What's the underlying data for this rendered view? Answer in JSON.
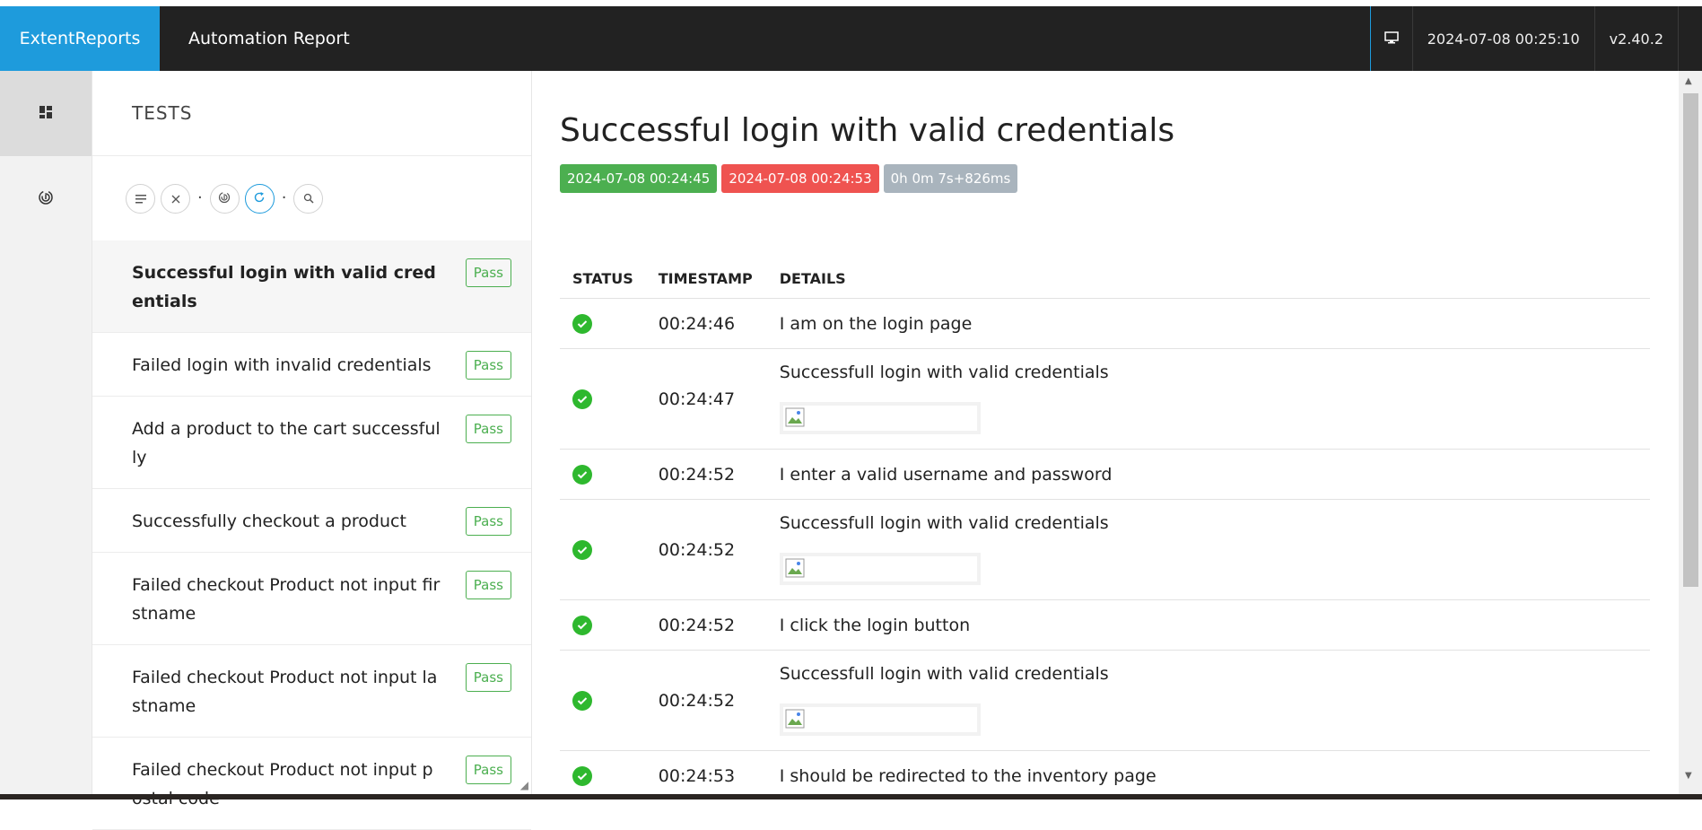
{
  "navbar": {
    "brand": "ExtentReports",
    "report_name": "Automation Report",
    "timestamp": "2024-07-08 00:25:10",
    "version": "v2.40.2",
    "monitor_icon": "monitor-icon"
  },
  "leftnav": {
    "items": [
      {
        "icon": "dashboard-icon",
        "active": true
      },
      {
        "icon": "fingerprint-icon",
        "active": false
      }
    ]
  },
  "tests_panel": {
    "title": "TESTS",
    "toolbar_icons": [
      "list-icon",
      "close-icon",
      "fingerprint-icon",
      "refresh-icon",
      "search-icon"
    ],
    "tests": [
      {
        "name": "Successful login with valid credentials",
        "status": "Pass",
        "active": true
      },
      {
        "name": "Failed login with invalid credentials",
        "status": "Pass",
        "active": false
      },
      {
        "name": "Add a product to the cart successfully",
        "status": "Pass",
        "active": false
      },
      {
        "name": "Successfully checkout a product",
        "status": "Pass",
        "active": false
      },
      {
        "name": "Failed checkout Product not input firstname",
        "status": "Pass",
        "active": false
      },
      {
        "name": "Failed checkout Product not input lastname",
        "status": "Pass",
        "active": false
      },
      {
        "name": "Failed checkout Product not input postal code",
        "status": "Pass",
        "active": false
      }
    ]
  },
  "detail": {
    "title": "Successful login with valid credentials",
    "start_time": "2024-07-08 00:24:45",
    "end_time": "2024-07-08 00:24:53",
    "duration": "0h 0m 7s+826ms",
    "columns": {
      "status": "STATUS",
      "timestamp": "TIMESTAMP",
      "details": "DETAILS"
    },
    "logs": [
      {
        "status": "pass",
        "timestamp": "00:24:46",
        "details": "I am on the login page",
        "has_image": false
      },
      {
        "status": "pass",
        "timestamp": "00:24:47",
        "details": "Successfull login with valid credentials",
        "has_image": true
      },
      {
        "status": "pass",
        "timestamp": "00:24:52",
        "details": "I enter a valid username and password",
        "has_image": false
      },
      {
        "status": "pass",
        "timestamp": "00:24:52",
        "details": "Successfull login with valid credentials",
        "has_image": true
      },
      {
        "status": "pass",
        "timestamp": "00:24:52",
        "details": "I click the login button",
        "has_image": false
      },
      {
        "status": "pass",
        "timestamp": "00:24:52",
        "details": "Successfull login with valid credentials",
        "has_image": true
      },
      {
        "status": "pass",
        "timestamp": "00:24:53",
        "details": "I should be redirected to the inventory page",
        "has_image": false
      }
    ]
  },
  "colors": {
    "brand_blue": "#1e9bdc",
    "navbar_dark": "#222222",
    "pass_green": "#4caf50",
    "fail_red": "#ef5350",
    "duration_grey": "#a9b4bd"
  }
}
